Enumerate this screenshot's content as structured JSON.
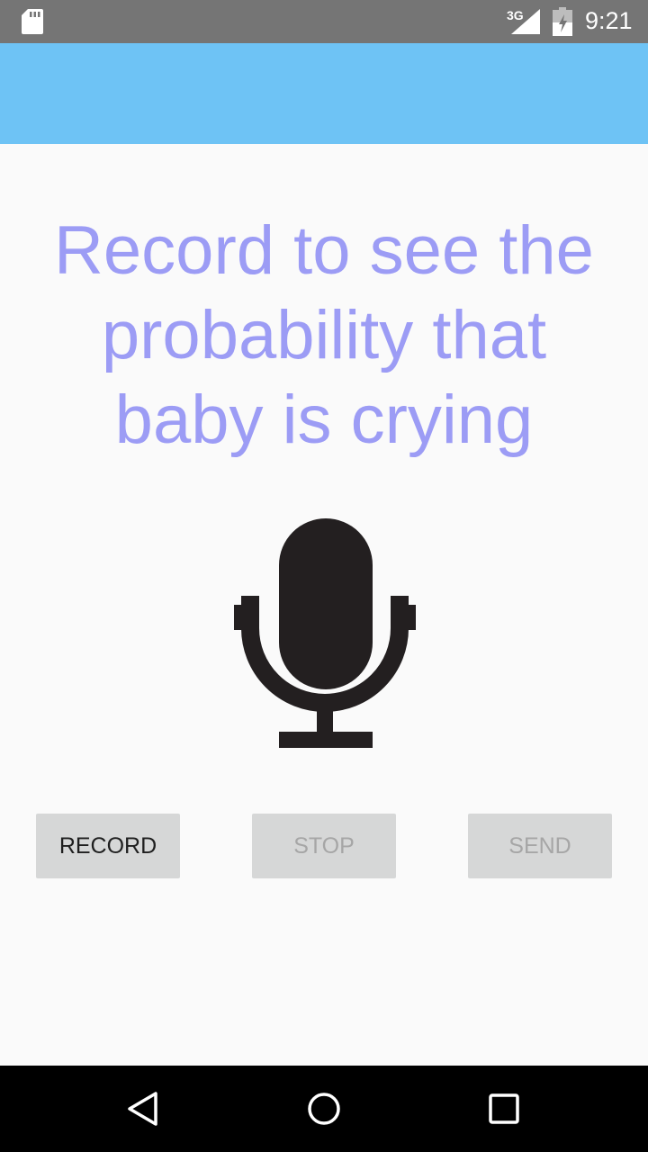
{
  "status_bar": {
    "network": "3G",
    "time": "9:21"
  },
  "main": {
    "headline": "Record to see the probability that baby is crying",
    "mic_icon": "microphone-icon"
  },
  "buttons": {
    "record": "RECORD",
    "stop": "STOP",
    "send": "SEND"
  },
  "nav": {
    "back_icon": "back-triangle-icon",
    "home_icon": "home-circle-icon",
    "recents_icon": "recents-square-icon"
  },
  "colors": {
    "app_bar": "#6ec3f5",
    "headline": "#9c9cf5",
    "button_bg": "#d6d7d7",
    "status_bar": "#757575"
  }
}
